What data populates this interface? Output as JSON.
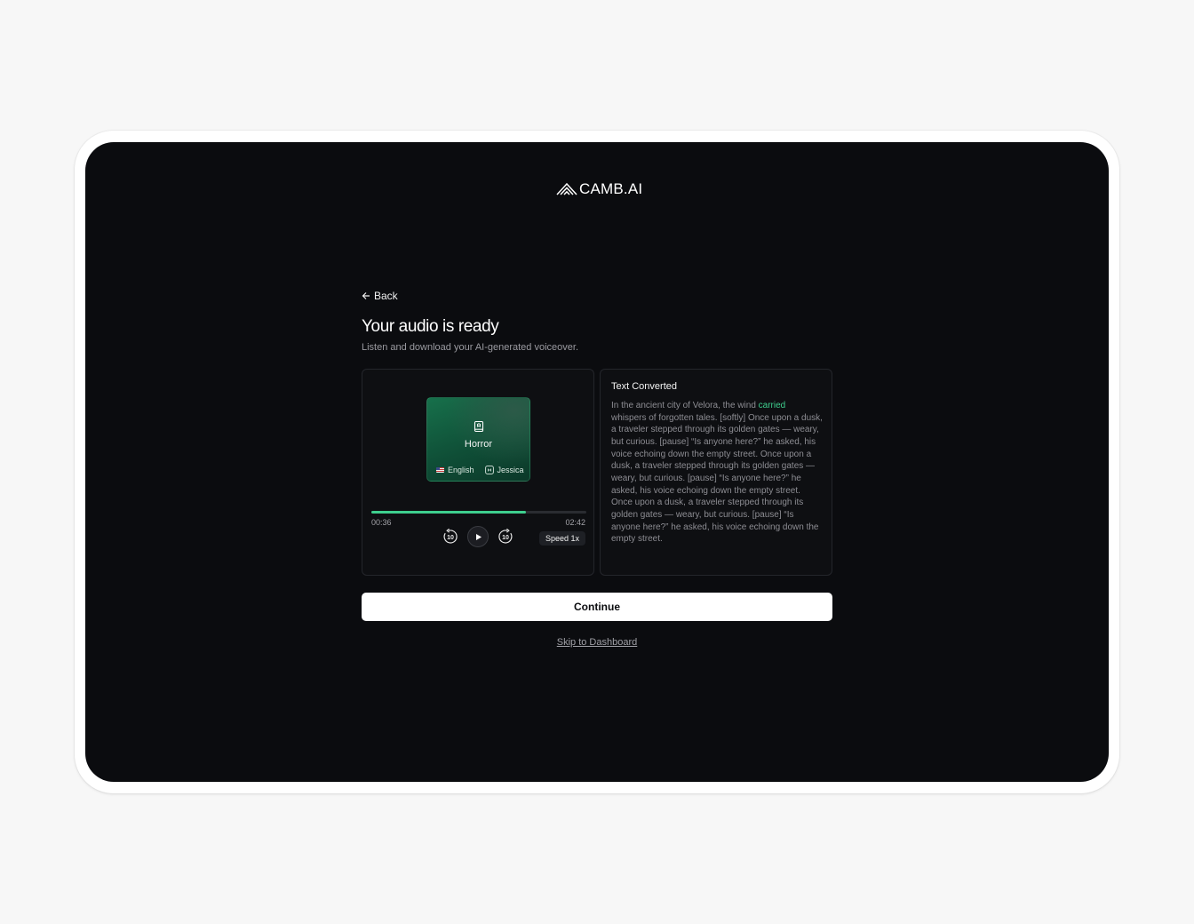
{
  "brand": {
    "name": "CAMB.AI"
  },
  "nav": {
    "back_label": "Back"
  },
  "header": {
    "title": "Your audio is ready",
    "subtitle": "Listen and download your AI-generated voiceover."
  },
  "player": {
    "genre": "Horror",
    "language": "English",
    "voice": "Jessica",
    "current_time": "00:36",
    "total_time": "02:42",
    "progress": 0.72,
    "rewind_label": "10",
    "forward_label": "10",
    "speed_label": "Speed 1x"
  },
  "text_panel": {
    "title": "Text Converted",
    "text_before": "In the ancient city of Velora, the wind ",
    "highlighted_word": "carried",
    "text_after": " whispers of forgotten tales. [softly] Once upon a dusk, a traveler stepped through its golden gates — weary, but curious. [pause] “Is anyone here?” he asked, his voice echoing down the empty street. Once upon a dusk, a traveler stepped through its golden gates — weary, but curious. [pause] “Is anyone here?” he asked, his voice echoing down the empty street. Once upon a dusk, a traveler stepped through its golden gates — weary, but curious. [pause] “Is anyone here?” he asked, his voice echoing down the empty street."
  },
  "actions": {
    "continue_label": "Continue",
    "skip_label": "Skip to Dashboard"
  },
  "colors": {
    "accent": "#3ecf8e",
    "background": "#0b0c0f",
    "page_background": "#f7f7f7"
  }
}
